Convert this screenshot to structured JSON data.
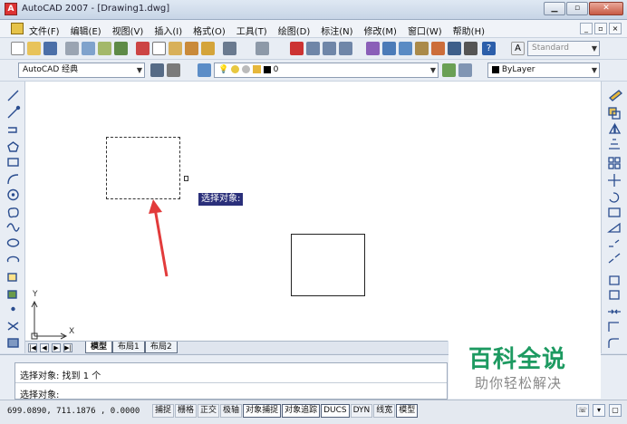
{
  "window": {
    "title": "AutoCAD 2007 - [Drawing1.dwg]"
  },
  "menu": [
    "文件(F)",
    "编辑(E)",
    "视图(V)",
    "插入(I)",
    "格式(O)",
    "工具(T)",
    "绘图(D)",
    "标注(N)",
    "修改(M)",
    "窗口(W)",
    "帮助(H)"
  ],
  "toolbar": {
    "text_style": "Standard"
  },
  "workspace": {
    "name": "AutoCAD 经典"
  },
  "layer": {
    "current": "0"
  },
  "color": {
    "current": "ByLayer"
  },
  "canvas": {
    "tooltip": "选择对象:",
    "ucs_x": "X",
    "ucs_y": "Y"
  },
  "tabs": [
    "模型",
    "布局1",
    "布局2"
  ],
  "command": {
    "line1": "选择对象: 找到 1 个",
    "line2": "选择对象:"
  },
  "watermark": {
    "title": "百科全说",
    "subtitle": "助你轻松解决"
  },
  "status": {
    "coords": "699.0890,  711.1876 , 0.0000",
    "buttons": [
      "捕捉",
      "栅格",
      "正交",
      "极轴",
      "对象捕捉",
      "对象追踪",
      "DUCS",
      "DYN",
      "线宽",
      "模型"
    ]
  },
  "colors": {
    "tooltip_bg": "#2a2f7a",
    "arrow": "#e23b3b",
    "watermark": "#1d9a61"
  }
}
